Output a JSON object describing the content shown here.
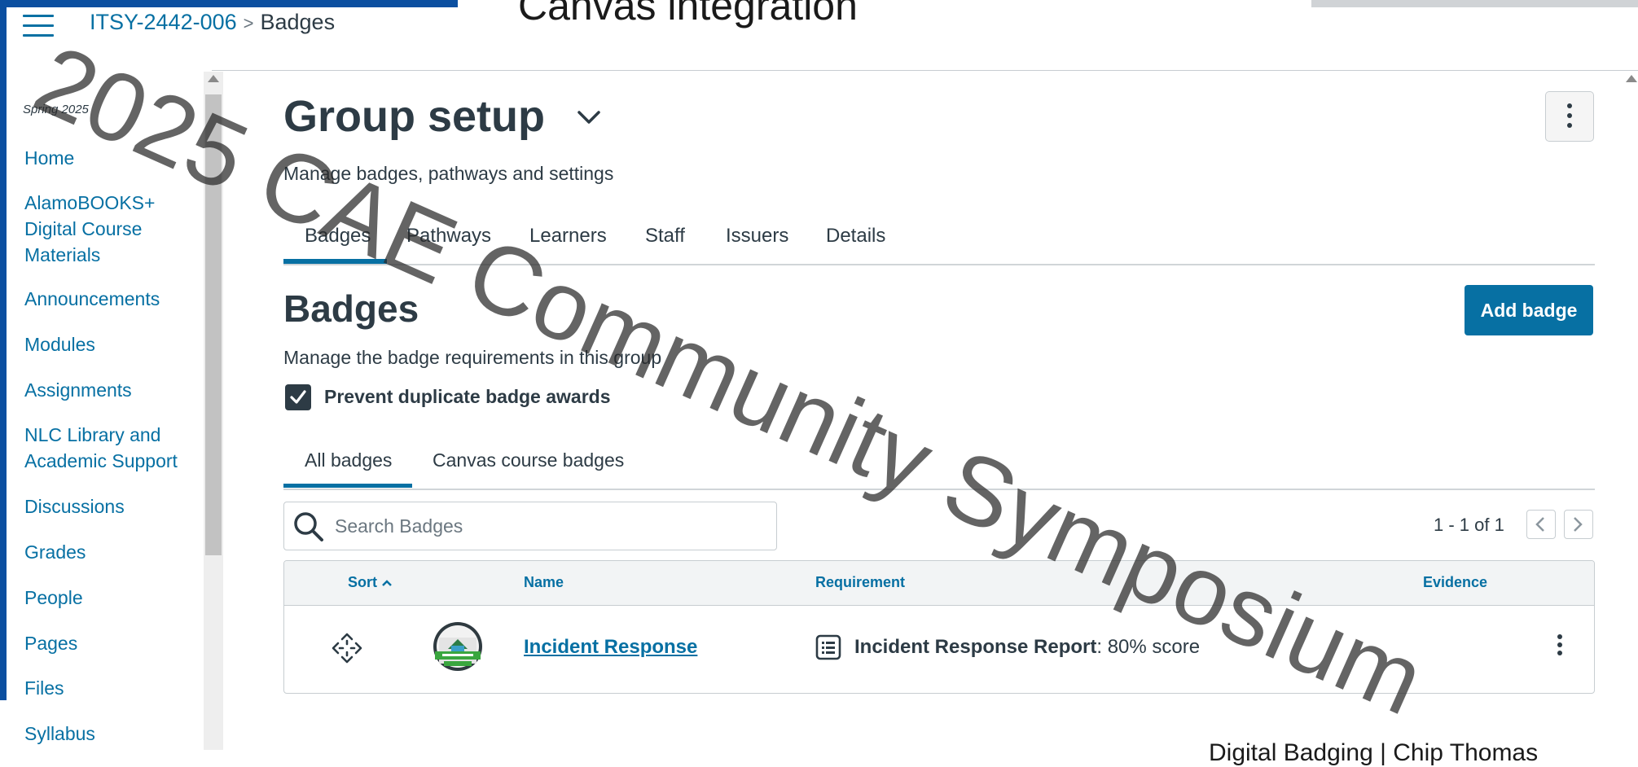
{
  "slide": {
    "title": "Canvas integration",
    "footer": "Digital Badging | Chip Thomas",
    "watermark": "2025 CAE Community Symposium"
  },
  "breadcrumb": {
    "course": "ITSY-2442-006",
    "separator": ">",
    "current": "Badges"
  },
  "sidebar": {
    "term": "Spring 2025",
    "items": [
      {
        "label": "Home"
      },
      {
        "label": "AlamoBOOKS+ Digital Course Materials"
      },
      {
        "label": "Announcements"
      },
      {
        "label": "Modules"
      },
      {
        "label": "Assignments"
      },
      {
        "label": "NLC Library and Academic Support"
      },
      {
        "label": "Discussions"
      },
      {
        "label": "Grades"
      },
      {
        "label": "People"
      },
      {
        "label": "Pages"
      },
      {
        "label": "Files"
      },
      {
        "label": "Syllabus"
      }
    ]
  },
  "page": {
    "title": "Group setup",
    "subtitle": "Manage badges, pathways and settings",
    "tabs": [
      {
        "label": "Badges",
        "active": true
      },
      {
        "label": "Pathways"
      },
      {
        "label": "Learners"
      },
      {
        "label": "Staff"
      },
      {
        "label": "Issuers"
      },
      {
        "label": "Details"
      }
    ]
  },
  "badges": {
    "title": "Badges",
    "add_button": "Add badge",
    "subtitle": "Manage the badge requirements in this group",
    "prevent_duplicates_label": "Prevent duplicate badge awards",
    "prevent_duplicates_checked": true,
    "subtabs": [
      {
        "label": "All badges",
        "active": true
      },
      {
        "label": "Canvas course badges"
      }
    ],
    "search_placeholder": "Search Badges",
    "pagination": "1 - 1 of 1",
    "table": {
      "headers": {
        "sort": "Sort",
        "name": "Name",
        "requirement": "Requirement",
        "evidence": "Evidence"
      },
      "rows": [
        {
          "name": "Incident Response",
          "requirement_title": "Incident Response Report",
          "requirement_detail": ": 80% score"
        }
      ]
    }
  },
  "colors": {
    "accent": "#0770a3",
    "text": "#2d3b45",
    "brand_bar": "#0b4fa0",
    "badge_green": "#3aa63f"
  }
}
